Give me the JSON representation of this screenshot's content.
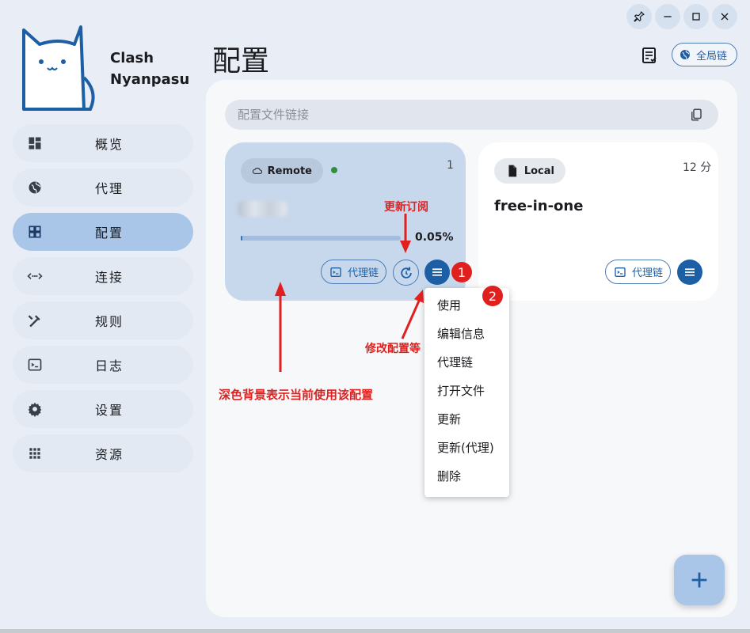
{
  "app": {
    "name_line1": "Clash",
    "name_line2": "Nyanpasu"
  },
  "sidebar": {
    "items": [
      {
        "label": "概览",
        "icon": "dashboard-icon"
      },
      {
        "label": "代理",
        "icon": "globe-icon"
      },
      {
        "label": "配置",
        "icon": "grid-icon",
        "active": true
      },
      {
        "label": "连接",
        "icon": "connection-icon"
      },
      {
        "label": "规则",
        "icon": "rules-icon"
      },
      {
        "label": "日志",
        "icon": "terminal-icon"
      },
      {
        "label": "设置",
        "icon": "gear-icon"
      },
      {
        "label": "资源",
        "icon": "apps-icon"
      }
    ]
  },
  "header": {
    "title": "配置",
    "global_chain_label": "全局链"
  },
  "url_bar": {
    "placeholder": "配置文件链接"
  },
  "profiles": [
    {
      "type_label": "Remote",
      "time": "1",
      "progress_percent": 0.05,
      "progress_text": "0.05%",
      "chain_button": "代理链",
      "selected": true
    },
    {
      "type_label": "Local",
      "time": "12 分",
      "name": "free-in-one",
      "chain_button": "代理链"
    }
  ],
  "context_menu": {
    "items": [
      "使用",
      "编辑信息",
      "代理链",
      "打开文件",
      "更新",
      "更新(代理)",
      "删除"
    ]
  },
  "annotations": {
    "badge1": "1",
    "badge2": "2",
    "update_note": "更新订阅",
    "modify_note": "修改配置等",
    "selected_note": "深色背景表示当前使用该配置"
  },
  "colors": {
    "accent": "#1d5fa5",
    "active_nav": "#a9c6e8",
    "annotation_red": "#e0201f",
    "online_dot": "#2f8f3e"
  }
}
